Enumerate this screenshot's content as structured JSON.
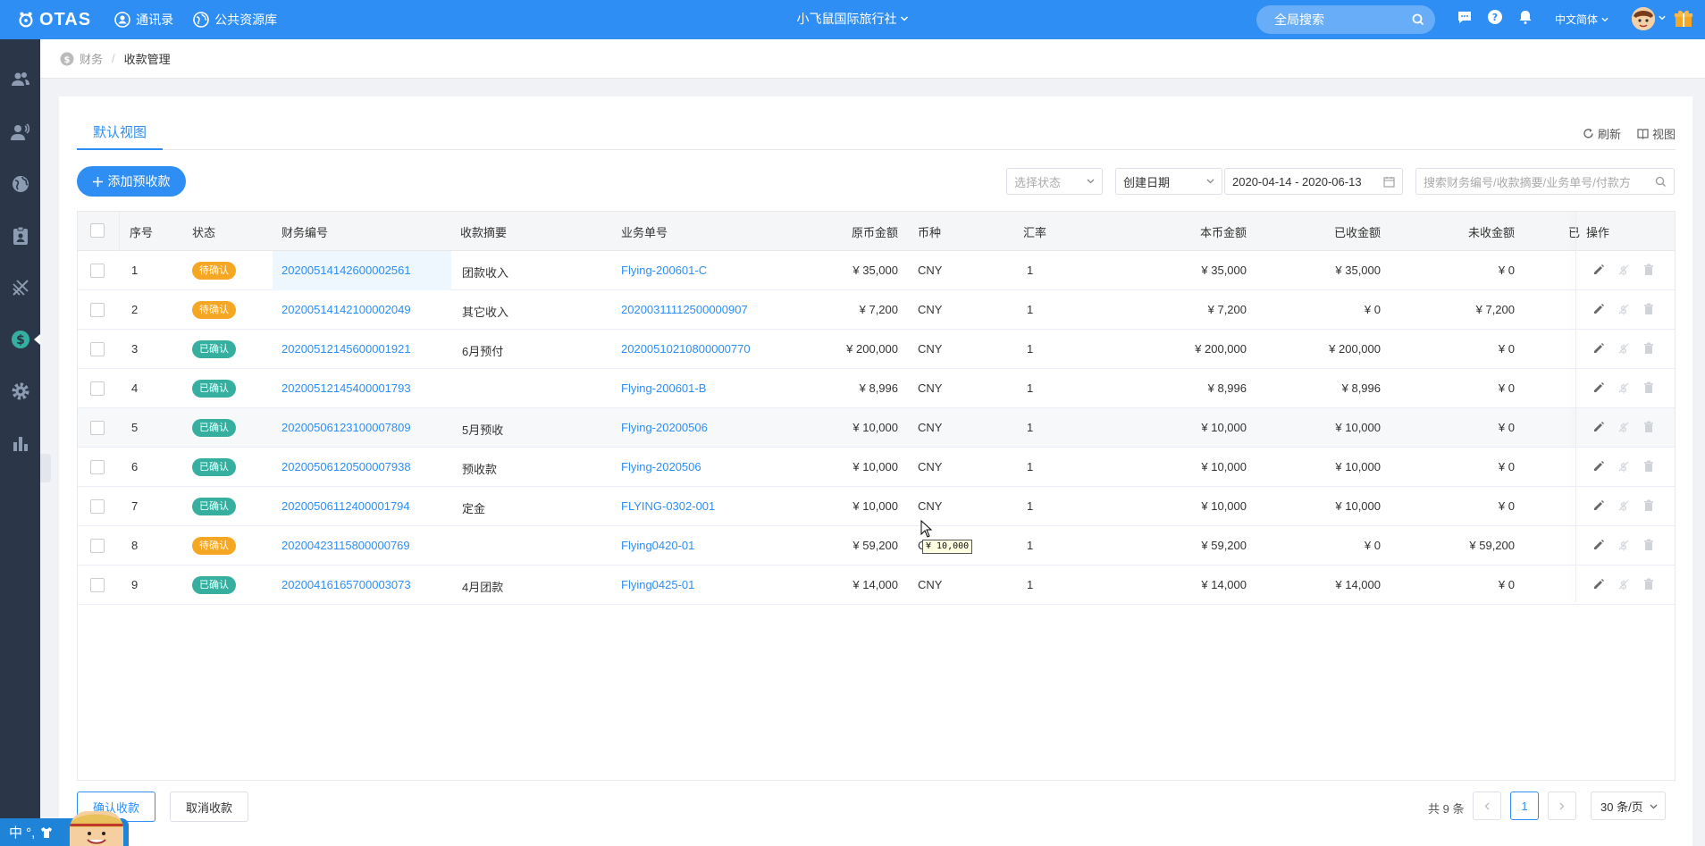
{
  "topbar": {
    "logo": "OTAS",
    "contacts": "通讯录",
    "public_resources": "公共资源库",
    "company": "小飞鼠国际旅行社",
    "global_search": "全局搜索",
    "language": "中文简体"
  },
  "breadcrumb": {
    "parent": "财务",
    "current": "收款管理"
  },
  "tabs": {
    "active": "默认视图",
    "refresh": "刷新",
    "view": "视图"
  },
  "toolbar": {
    "add_button": "添加预收款",
    "status_placeholder": "选择状态",
    "date_type": "创建日期",
    "date_range": "2020-04-14 - 2020-06-13",
    "search_placeholder": "搜索财务编号/收款摘要/业务单号/付款方"
  },
  "table": {
    "headers": {
      "seq": "序号",
      "status": "状态",
      "fin_no": "财务编号",
      "summary": "收款摘要",
      "biz_no": "业务单号",
      "orig_amount": "原币金额",
      "currency": "币种",
      "rate": "汇率",
      "local_amount": "本币金额",
      "received": "已收金额",
      "unreceived": "未收金额",
      "truncated": "已",
      "ops": "操作"
    },
    "rows": [
      {
        "seq": "1",
        "status": "待确认",
        "status_type": "pending",
        "fin_no": "20200514142600002561",
        "summary": "团款收入",
        "biz_no": "Flying-200601-C",
        "orig_amount": "¥ 35,000",
        "currency": "CNY",
        "rate": "1",
        "local_amount": "¥ 35,000",
        "received": "¥ 35,000",
        "unreceived": "¥ 0"
      },
      {
        "seq": "2",
        "status": "待确认",
        "status_type": "pending",
        "fin_no": "20200514142100002049",
        "summary": "其它收入",
        "biz_no": "20200311112500000907",
        "orig_amount": "¥ 7,200",
        "currency": "CNY",
        "rate": "1",
        "local_amount": "¥ 7,200",
        "received": "¥ 0",
        "unreceived": "¥ 7,200"
      },
      {
        "seq": "3",
        "status": "已确认",
        "status_type": "confirmed",
        "fin_no": "20200512145600001921",
        "summary": "6月预付",
        "biz_no": "20200510210800000770",
        "orig_amount": "¥ 200,000",
        "currency": "CNY",
        "rate": "1",
        "local_amount": "¥ 200,000",
        "received": "¥ 200,000",
        "unreceived": "¥ 0"
      },
      {
        "seq": "4",
        "status": "已确认",
        "status_type": "confirmed",
        "fin_no": "20200512145400001793",
        "summary": "",
        "biz_no": "Flying-200601-B",
        "orig_amount": "¥ 8,996",
        "currency": "CNY",
        "rate": "1",
        "local_amount": "¥ 8,996",
        "received": "¥ 8,996",
        "unreceived": "¥ 0"
      },
      {
        "seq": "5",
        "status": "已确认",
        "status_type": "confirmed",
        "fin_no": "20200506123100007809",
        "summary": "5月预收",
        "biz_no": "Flying-20200506",
        "orig_amount": "¥ 10,000",
        "currency": "CNY",
        "rate": "1",
        "local_amount": "¥ 10,000",
        "received": "¥ 10,000",
        "unreceived": "¥ 0"
      },
      {
        "seq": "6",
        "status": "已确认",
        "status_type": "confirmed",
        "fin_no": "20200506120500007938",
        "summary": "预收款",
        "biz_no": "Flying-2020506",
        "orig_amount": "¥ 10,000",
        "currency": "CNY",
        "rate": "1",
        "local_amount": "¥ 10,000",
        "received": "¥ 10,000",
        "unreceived": "¥ 0"
      },
      {
        "seq": "7",
        "status": "已确认",
        "status_type": "confirmed",
        "fin_no": "20200506112400001794",
        "summary": "定金",
        "biz_no": "FLYING-0302-001",
        "orig_amount": "¥ 10,000",
        "currency": "CNY",
        "rate": "1",
        "local_amount": "¥ 10,000",
        "received": "¥ 10,000",
        "unreceived": "¥ 0"
      },
      {
        "seq": "8",
        "status": "待确认",
        "status_type": "pending",
        "fin_no": "20200423115800000769",
        "summary": "",
        "biz_no": "Flying0420-01",
        "orig_amount": "¥ 59,200",
        "currency": "CNY",
        "rate": "1",
        "local_amount": "¥ 59,200",
        "received": "¥ 0",
        "unreceived": "¥ 59,200"
      },
      {
        "seq": "9",
        "status": "已确认",
        "status_type": "confirmed",
        "fin_no": "20200416165700003073",
        "summary": "4月团款",
        "biz_no": "Flying0425-01",
        "orig_amount": "¥ 14,000",
        "currency": "CNY",
        "rate": "1",
        "local_amount": "¥ 14,000",
        "received": "¥ 14,000",
        "unreceived": "¥ 0"
      }
    ],
    "tooltip": "¥ 10,000"
  },
  "footer": {
    "confirm": "确认收款",
    "cancel": "取消收款",
    "total": "共 9 条",
    "page": "1",
    "page_size": "30 条/页"
  },
  "ime": {
    "label": "中 °,"
  },
  "colors": {
    "primary": "#2e8ef4",
    "sidebar": "#2b3648",
    "pending": "#f5a623",
    "confirmed": "#35b0a0"
  }
}
